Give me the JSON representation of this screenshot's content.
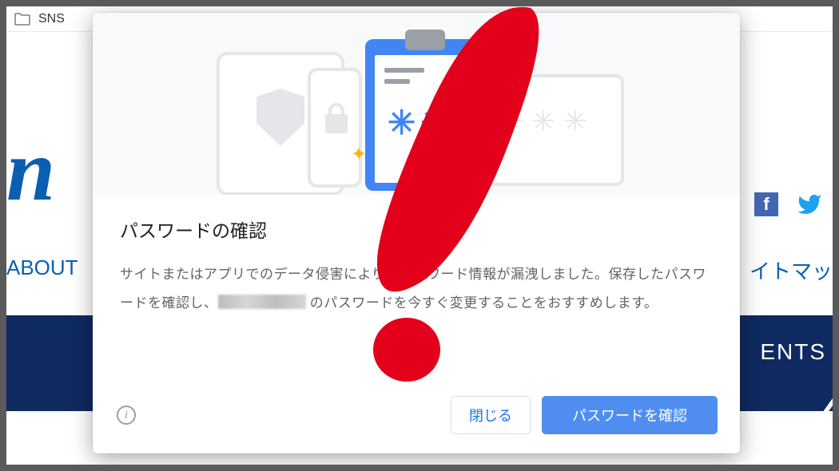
{
  "bookmark_bar": {
    "folder_label": "SNS"
  },
  "background": {
    "logo_fragment": "n",
    "nav_left_fragment": "ABOUT",
    "nav_right_fragment": "イトマッ",
    "band_text_fragment": "ENTS"
  },
  "dialog": {
    "title": "パスワードの確認",
    "body_before": "サイトまたはアプリでのデータ侵害により、パスワード情報が漏洩しました。保存したパスワードを確認し、",
    "body_after": " のパスワードを今すぐ変更することをおすすめします。",
    "close_label": "閉じる",
    "confirm_label": "パスワードを確認",
    "paper_stars": "✳✳",
    "laptop_stars": "✳✳✳"
  }
}
